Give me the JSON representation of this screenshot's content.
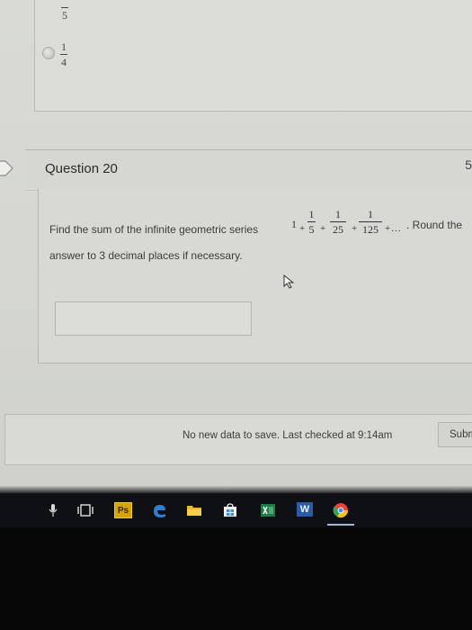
{
  "previous_question": {
    "top_fraction": {
      "numerator": "",
      "denominator": "5"
    },
    "option": {
      "numerator": "1",
      "denominator": "4"
    }
  },
  "question": {
    "title": "Question 20",
    "points": "5",
    "text_before": "Find the sum of the infinite geometric series",
    "series_lead": "1",
    "plus": "+",
    "series_terms": [
      {
        "numerator": "1",
        "denominator": "5"
      },
      {
        "numerator": "1",
        "denominator": "25"
      },
      {
        "numerator": "1",
        "denominator": "125"
      }
    ],
    "ellipsis": "+...",
    "text_after": ". Round the",
    "text_line2": "answer to 3 decimal places if necessary.",
    "answer_value": ""
  },
  "footer": {
    "save_status": "No new data to save. Last checked at 9:14am",
    "submit_label": "Subm"
  },
  "taskbar": {
    "icons": [
      "microphone-icon",
      "task-view-icon",
      "photoshop-icon",
      "edge-icon",
      "file-explorer-icon",
      "store-icon",
      "excel-icon",
      "word-icon",
      "chrome-icon"
    ],
    "ps_label": "Ps",
    "word_label": "W"
  },
  "colors": {
    "screen_bg": "#d8d9d5",
    "taskbar_bg": "#0f1013",
    "edge_blue": "#2f7fd6",
    "excel_green": "#1f7a45",
    "word_blue": "#2b5ba8"
  }
}
